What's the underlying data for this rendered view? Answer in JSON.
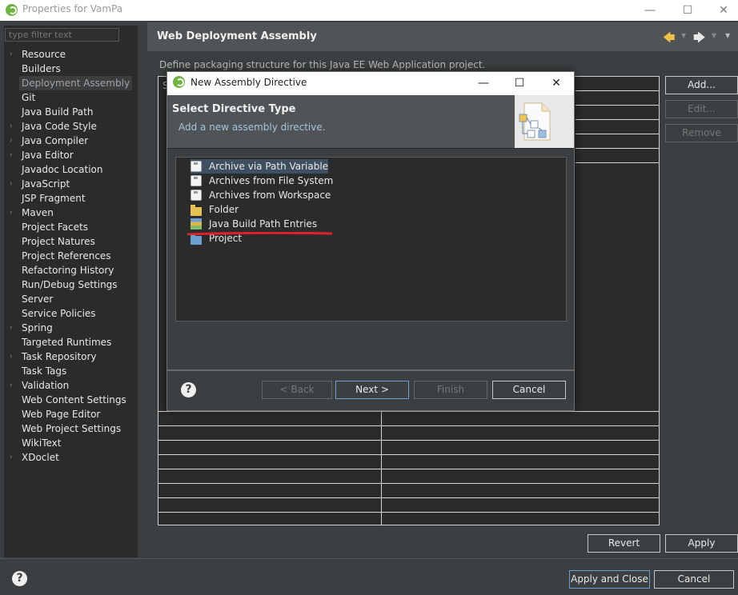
{
  "window": {
    "title": "Properties for VamPa",
    "minimize": "—",
    "maximize": "☐",
    "close": "✕"
  },
  "filter": {
    "placeholder": "type filter text"
  },
  "sidebar": {
    "items": [
      {
        "label": "Resource",
        "expandable": true
      },
      {
        "label": "Builders",
        "expandable": false
      },
      {
        "label": "Deployment Assembly",
        "expandable": false,
        "selected": true
      },
      {
        "label": "Git",
        "expandable": false
      },
      {
        "label": "Java Build Path",
        "expandable": false
      },
      {
        "label": "Java Code Style",
        "expandable": true
      },
      {
        "label": "Java Compiler",
        "expandable": true
      },
      {
        "label": "Java Editor",
        "expandable": true
      },
      {
        "label": "Javadoc Location",
        "expandable": false
      },
      {
        "label": "JavaScript",
        "expandable": true
      },
      {
        "label": "JSP Fragment",
        "expandable": false
      },
      {
        "label": "Maven",
        "expandable": true
      },
      {
        "label": "Project Facets",
        "expandable": false
      },
      {
        "label": "Project Natures",
        "expandable": false
      },
      {
        "label": "Project References",
        "expandable": false
      },
      {
        "label": "Refactoring History",
        "expandable": false
      },
      {
        "label": "Run/Debug Settings",
        "expandable": false
      },
      {
        "label": "Server",
        "expandable": false
      },
      {
        "label": "Service Policies",
        "expandable": false
      },
      {
        "label": "Spring",
        "expandable": true
      },
      {
        "label": "Targeted Runtimes",
        "expandable": false
      },
      {
        "label": "Task Repository",
        "expandable": true
      },
      {
        "label": "Task Tags",
        "expandable": false
      },
      {
        "label": "Validation",
        "expandable": true
      },
      {
        "label": "Web Content Settings",
        "expandable": false
      },
      {
        "label": "Web Page Editor",
        "expandable": false
      },
      {
        "label": "Web Project Settings",
        "expandable": false
      },
      {
        "label": "WikiText",
        "expandable": false
      },
      {
        "label": "XDoclet",
        "expandable": true
      }
    ]
  },
  "page": {
    "title": "Web Deployment Assembly",
    "description": "Define packaging structure for this Java EE Web Application project.",
    "table_header_fragment": "S",
    "buttons": {
      "add": "Add...",
      "edit": "Edit...",
      "remove": "Remove"
    },
    "revert": "Revert",
    "apply": "Apply"
  },
  "footer": {
    "apply_and_close": "Apply and Close",
    "cancel": "Cancel",
    "help": "?"
  },
  "dialog": {
    "title": "New Assembly Directive",
    "heading": "Select Directive Type",
    "subtitle": "Add a new assembly directive.",
    "items": [
      {
        "label": "Archive via Path Variable",
        "icon": "jar-icon",
        "selected": true
      },
      {
        "label": "Archives from File System",
        "icon": "jar-icon"
      },
      {
        "label": "Archives from Workspace",
        "icon": "jar-icon"
      },
      {
        "label": "Folder",
        "icon": "folder-icon"
      },
      {
        "label": "Java Build Path Entries",
        "icon": "library-icon"
      },
      {
        "label": "Project",
        "icon": "project-icon"
      }
    ],
    "buttons": {
      "back": "< Back",
      "next": "Next >",
      "finish": "Finish",
      "cancel": "Cancel"
    },
    "help": "?"
  },
  "colors": {
    "annotation_underline": "#e0202a",
    "selected_row": "#3d4f60",
    "spring_green": "#6db33f"
  }
}
